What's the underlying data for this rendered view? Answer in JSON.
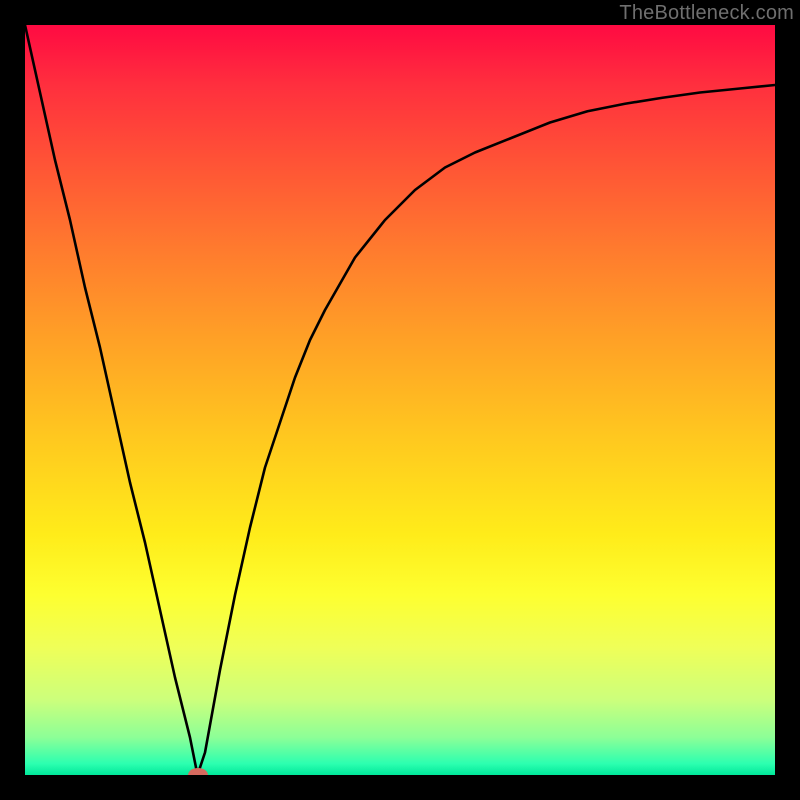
{
  "watermark": "TheBottleneck.com",
  "chart_data": {
    "type": "line",
    "title": "",
    "xlabel": "",
    "ylabel": "",
    "xlim": [
      0,
      100
    ],
    "ylim": [
      0,
      100
    ],
    "grid": false,
    "legend": false,
    "series": [
      {
        "name": "bottleneck-curve",
        "color": "#000000",
        "x": [
          0,
          2,
          4,
          6,
          8,
          10,
          12,
          14,
          16,
          18,
          20,
          22,
          23,
          24,
          26,
          28,
          30,
          32,
          34,
          36,
          38,
          40,
          44,
          48,
          52,
          56,
          60,
          65,
          70,
          75,
          80,
          85,
          90,
          95,
          100
        ],
        "y": [
          100,
          91,
          82,
          74,
          65,
          57,
          48,
          39,
          31,
          22,
          13,
          5,
          0,
          3,
          14,
          24,
          33,
          41,
          47,
          53,
          58,
          62,
          69,
          74,
          78,
          81,
          83,
          85,
          87,
          88.5,
          89.5,
          90.3,
          91,
          91.5,
          92
        ]
      }
    ],
    "marker": {
      "name": "optimal-point",
      "x": 23,
      "y": 0,
      "color": "#d66a5f"
    },
    "background_gradient": {
      "stops": [
        {
          "offset": 0.0,
          "color": "#ff0a42"
        },
        {
          "offset": 0.08,
          "color": "#ff2f3e"
        },
        {
          "offset": 0.18,
          "color": "#ff5236"
        },
        {
          "offset": 0.3,
          "color": "#ff7b2e"
        },
        {
          "offset": 0.42,
          "color": "#ffa126"
        },
        {
          "offset": 0.55,
          "color": "#ffc81f"
        },
        {
          "offset": 0.68,
          "color": "#ffec1a"
        },
        {
          "offset": 0.76,
          "color": "#fdff30"
        },
        {
          "offset": 0.83,
          "color": "#efff58"
        },
        {
          "offset": 0.9,
          "color": "#ccff7c"
        },
        {
          "offset": 0.95,
          "color": "#8cff97"
        },
        {
          "offset": 0.985,
          "color": "#2cffb0"
        },
        {
          "offset": 1.0,
          "color": "#00e89a"
        }
      ]
    }
  }
}
